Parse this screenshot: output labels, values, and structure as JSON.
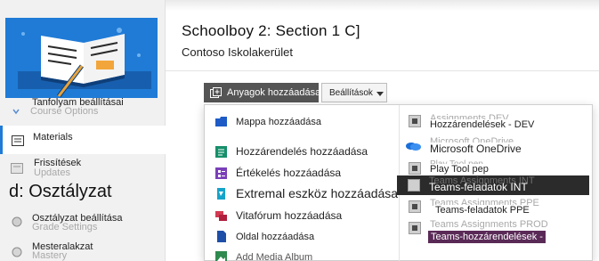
{
  "header": {
    "title": "Schoolboy 2: Section 1 C]",
    "subtitle": "Contoso Iskolakerület"
  },
  "sidebar": {
    "settings_label": "Tanfolyam beállításai",
    "settings_ghost": "Course Options",
    "materials_label": "Materials",
    "updates_label": "Frissítések",
    "updates_ghost": "Updates",
    "grades_heading": "d: Osztályzat",
    "grade_settings_label": "Osztályzat beállítása",
    "grade_settings_ghost": "Grade Settings",
    "master_label": "Mesteralakzat",
    "master_ghost": "Mastery"
  },
  "toolbar": {
    "add_label": "Anyagok hozzáadása",
    "settings_label": "Beállítások",
    "settings_ghost": "S"
  },
  "menu": {
    "left_items": [
      {
        "label": "Mappa hozzáadása",
        "icon": "folder-icon",
        "color": "#1e5bc6"
      },
      {
        "label": "Hozzárendelés hozzáadása",
        "icon": "assignment-icon",
        "color": "#168f6a"
      },
      {
        "label": "Értékelés hozzáadása",
        "icon": "assessment-icon",
        "color": "#7a3fb8"
      },
      {
        "label": "Extremal eszköz hozzáadása",
        "icon": "lti-tool-icon",
        "color": "#16a3c9"
      },
      {
        "label": "Vitafórum hozzáadása",
        "icon": "discussion-icon",
        "color": "#d23a52"
      },
      {
        "label": "Oldal hozzáadása",
        "icon": "page-icon",
        "color": "#1e4fa8"
      },
      {
        "label": "Add Media Album",
        "icon": "media-album-icon",
        "color": "#2f8a4f"
      }
    ],
    "right_items": [
      {
        "label": "Hozzárendelések - DEV",
        "ghost": "Assignments DEV"
      },
      {
        "label": "Microsoft OneDrive",
        "ghost": "Microsoft OneDrive"
      },
      {
        "label": "Play Tool pep",
        "ghost": "Play Tool pep"
      },
      {
        "label": "Teams-feladatok INT",
        "ghost": "Teams Assignments INT"
      },
      {
        "label": "Teams-feladatok PPE",
        "ghost": "Teams Assignments PPE"
      },
      {
        "label": "Teams-hozzárendelések -",
        "ghost": "Teams Assignments PROD"
      }
    ]
  },
  "colors": {
    "accent": "#1f7bd6",
    "highlight_row": "#2b2b2b",
    "purple_label": "#5a2a57"
  }
}
